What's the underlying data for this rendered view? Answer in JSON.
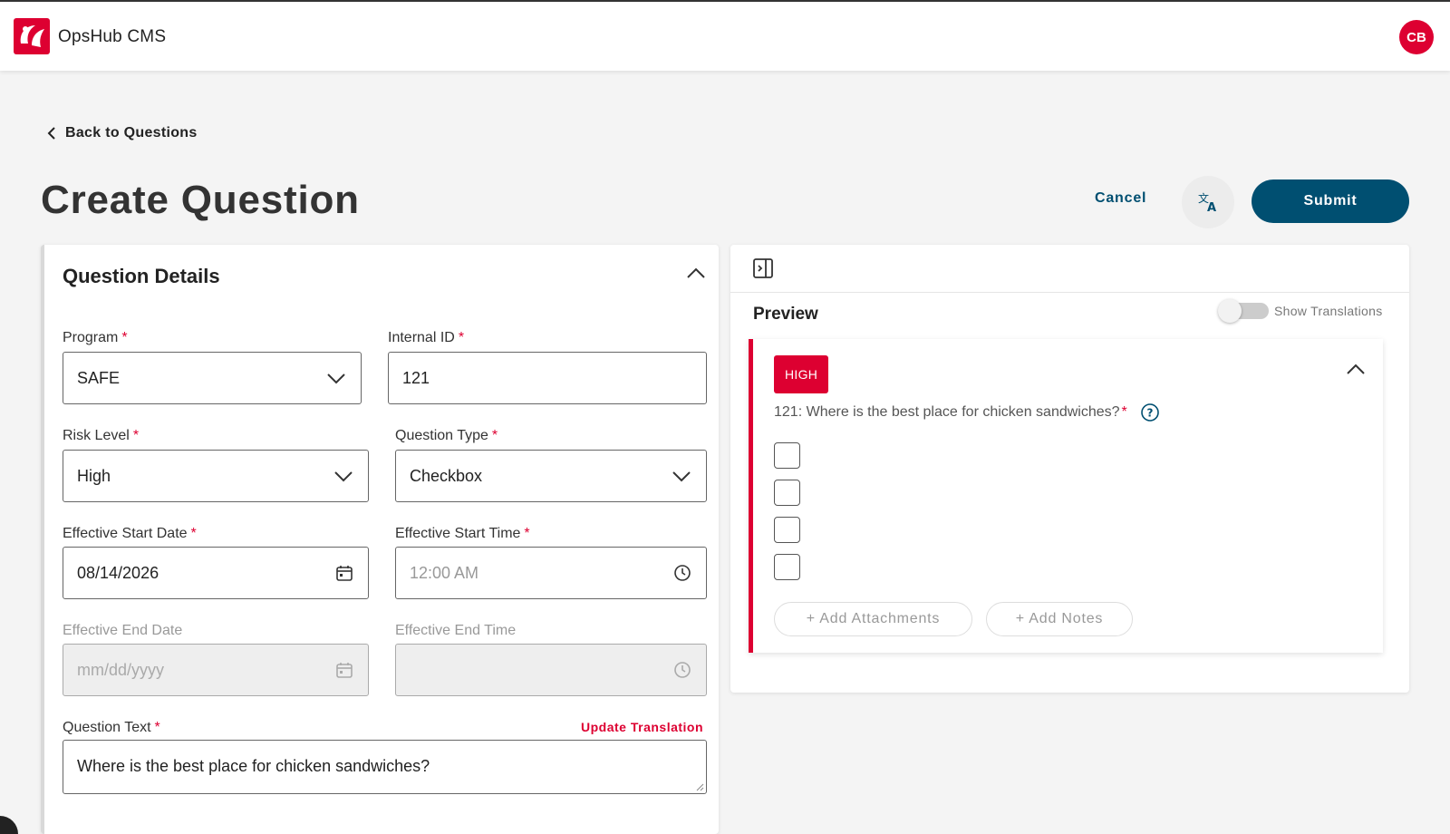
{
  "header": {
    "app_title": "OpsHub CMS",
    "avatar_initials": "CB"
  },
  "nav": {
    "back_label": "Back to Questions"
  },
  "page": {
    "title": "Create Question"
  },
  "actions": {
    "cancel_label": "Cancel",
    "translate_icon": "translate-icon",
    "submit_label": "Submit"
  },
  "details": {
    "title": "Question Details",
    "required_marker": "*",
    "program": {
      "label": "Program",
      "value": "SAFE"
    },
    "internal_id": {
      "label": "Internal ID",
      "value": "121"
    },
    "risk_level": {
      "label": "Risk Level",
      "value": "High"
    },
    "question_type": {
      "label": "Question Type",
      "value": "Checkbox"
    },
    "start_date": {
      "label": "Effective Start Date",
      "value": "08/14/2026"
    },
    "start_time": {
      "label": "Effective Start Time",
      "placeholder": "12:00 AM"
    },
    "end_date": {
      "label": "Effective End Date",
      "placeholder": "mm/dd/yyyy"
    },
    "end_time": {
      "label": "Effective End Time",
      "placeholder": ""
    },
    "question_text": {
      "label": "Question Text",
      "value": "Where is the best place for chicken sandwiches?",
      "update_translation_label": "Update Translation"
    }
  },
  "preview": {
    "title": "Preview",
    "show_translations_label": "Show Translations",
    "show_translations_on": false,
    "badge": "HIGH",
    "question": "121: Where is the best place for chicken sandwiches?",
    "checkbox_count": 4,
    "add_attachments_label": "+ Add Attachments",
    "add_notes_label": "+ Add Notes"
  },
  "colors": {
    "brand_red": "#dd0031",
    "primary_blue": "#004f71"
  }
}
